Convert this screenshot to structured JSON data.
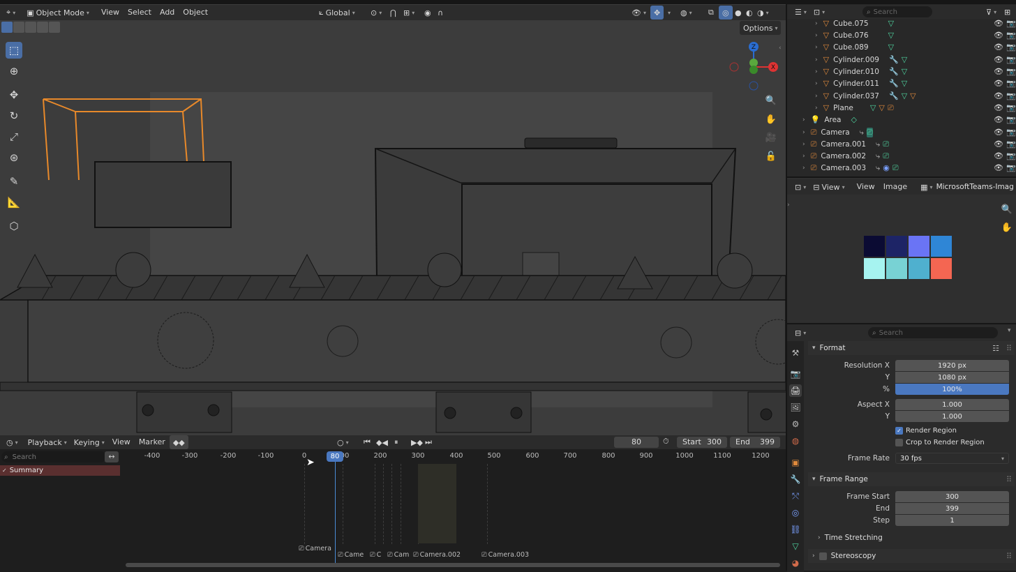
{
  "viewport": {
    "mode_label": "Object Mode",
    "menus": [
      "View",
      "Select",
      "Add",
      "Object"
    ],
    "orientation_label": "Global",
    "options_label": "Options",
    "gizmo_labels": {
      "z": "Z",
      "x": "X"
    }
  },
  "outliner": {
    "search_placeholder": "Search",
    "items": [
      {
        "name": "Cube.075"
      },
      {
        "name": "Cube.076"
      },
      {
        "name": "Cube.089"
      },
      {
        "name": "Cylinder.009"
      },
      {
        "name": "Cylinder.010"
      },
      {
        "name": "Cylinder.011"
      },
      {
        "name": "Cylinder.037"
      },
      {
        "name": "Plane"
      },
      {
        "name": "Area"
      },
      {
        "name": "Camera"
      },
      {
        "name": "Camera.001"
      },
      {
        "name": "Camera.002"
      },
      {
        "name": "Camera.003"
      }
    ]
  },
  "image_editor": {
    "menus": [
      "View",
      "View",
      "Image"
    ],
    "image_name": "MicrosoftTeams-Imag",
    "swatches": [
      "#0b0b33",
      "#1d2466",
      "#6a74f5",
      "#2f86d6",
      "#a6f3f0",
      "#78d2d4",
      "#4fb0cf",
      "#f46652"
    ]
  },
  "properties": {
    "search_placeholder": "Search",
    "format_title": "Format",
    "resolution_x_label": "Resolution X",
    "resolution_x": "1920 px",
    "y_label": "Y",
    "resolution_y": "1080 px",
    "percent_label": "%",
    "percent": "100%",
    "aspect_x_label": "Aspect X",
    "aspect_x": "1.000",
    "aspect_y_label": "Y",
    "aspect_y": "1.000",
    "render_region_label": "Render Region",
    "crop_label": "Crop to Render Region",
    "frame_rate_label": "Frame Rate",
    "frame_rate": "30 fps",
    "frame_range_title": "Frame Range",
    "frame_start_label": "Frame Start",
    "frame_start": "300",
    "end_label": "End",
    "frame_end": "399",
    "step_label": "Step",
    "step": "1",
    "time_stretching_label": "Time Stretching",
    "stereoscopy_label": "Stereoscopy"
  },
  "timeline": {
    "menus": [
      "Playback",
      "Keying",
      "View",
      "Marker"
    ],
    "current_frame": "80",
    "start_label": "Start",
    "start": "300",
    "end_label": "End",
    "end": "399",
    "search_placeholder": "Search",
    "summary_label": "Summary",
    "ticks": [
      "-400",
      "-300",
      "-200",
      "-100",
      "0",
      "00",
      "200",
      "300",
      "400",
      "500",
      "600",
      "700",
      "800",
      "900",
      "1000",
      "1100",
      "1200"
    ],
    "playhead_label": "80",
    "markers": [
      "Camera",
      "Came",
      "C",
      "Cam",
      "Camera.002",
      "Camera.003"
    ]
  }
}
